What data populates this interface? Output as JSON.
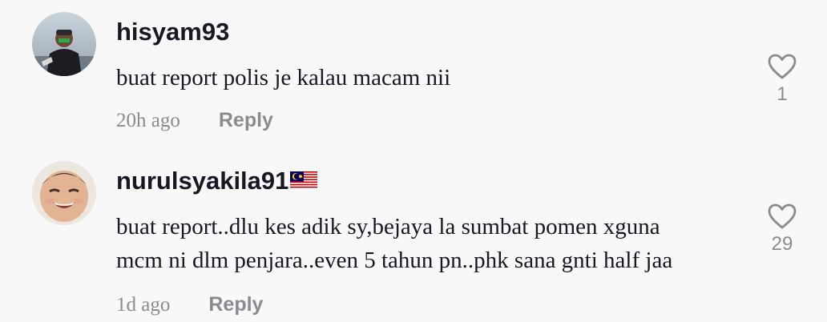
{
  "comments": [
    {
      "username": "hisyam93",
      "text_lines": [
        "buat report polis je kalau macam nii"
      ],
      "time": "20h ago",
      "reply_label": "Reply",
      "likes": "1",
      "avatar_icon": "user-photo-avatar",
      "like_icon": "heart-outline-icon"
    },
    {
      "username": "nurulsyakila91",
      "flag_icon": "malaysia-flag-icon",
      "text_lines": [
        "buat report..dlu kes adik sy,bejaya la sumbat pomen xguna",
        "mcm ni dlm penjara..even 5 tahun pn..phk sana gnti half jaa"
      ],
      "time": "1d ago",
      "reply_label": "Reply",
      "likes": "29",
      "avatar_icon": "baby-photo-avatar",
      "like_icon": "heart-outline-icon"
    }
  ],
  "colors": {
    "background": "#f8f8f8",
    "primary_text": "#161823",
    "secondary_text": "#8a8b91"
  }
}
